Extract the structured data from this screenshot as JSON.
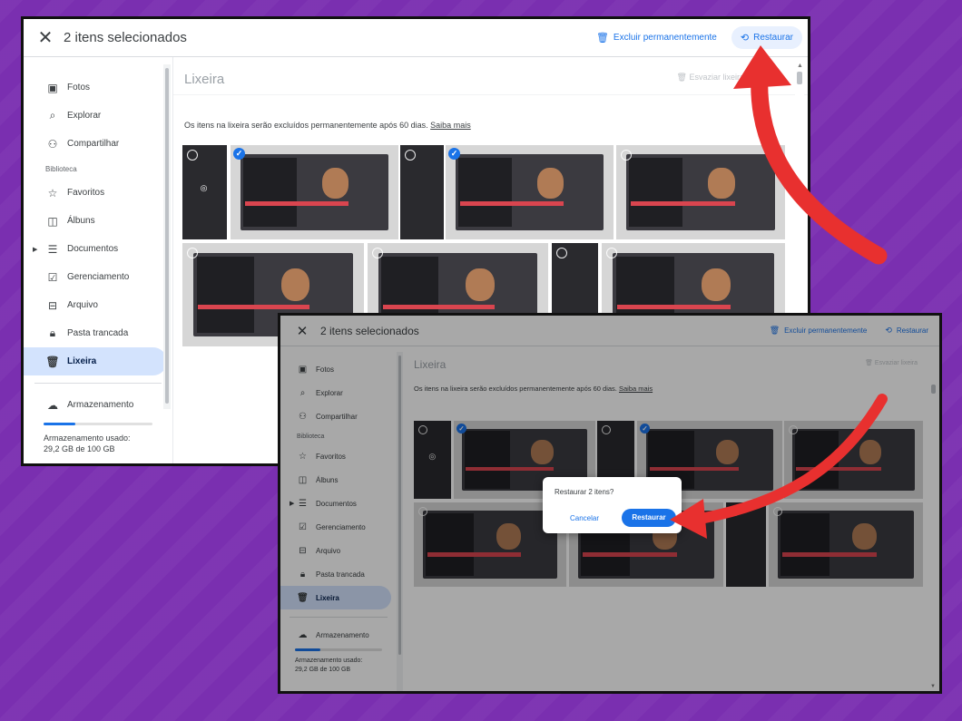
{
  "colors": {
    "background": "#7a2fb0",
    "accent": "#1a73e8",
    "arrow": "#e8302f",
    "active_nav": "#d3e3fd"
  },
  "topbar": {
    "close_icon": "close-icon",
    "title": "2 itens selecionados",
    "delete_label": "Excluir permanentemente",
    "restore_label": "Restaurar"
  },
  "sidebar": {
    "items": [
      {
        "label": "Fotos",
        "icon": "photo-icon"
      },
      {
        "label": "Explorar",
        "icon": "search-icon"
      },
      {
        "label": "Compartilhar",
        "icon": "people-icon"
      }
    ],
    "library_label": "Biblioteca",
    "library_items": [
      {
        "label": "Favoritos",
        "icon": "star-icon"
      },
      {
        "label": "Álbuns",
        "icon": "album-icon"
      },
      {
        "label": "Documentos",
        "icon": "document-icon"
      },
      {
        "label": "Gerenciamento",
        "icon": "checklist-icon"
      },
      {
        "label": "Arquivo",
        "icon": "archive-icon"
      },
      {
        "label": "Pasta trancada",
        "icon": "lock-icon"
      },
      {
        "label": "Lixeira",
        "icon": "trash-icon",
        "active": true
      }
    ],
    "storage_label": "Armazenamento",
    "storage_used_label": "Armazenamento usado:",
    "storage_value": "29,2 GB de 100 GB",
    "storage_fraction": 0.292
  },
  "main": {
    "title": "Lixeira",
    "empty_action": "Esvaziar lixeira",
    "note": "Os itens na lixeira serão excluídos permanentemente após 60 dias.",
    "learn_more": "Saiba mais"
  },
  "dialog": {
    "title": "Restaurar 2 itens?",
    "cancel_label": "Cancelar",
    "confirm_label": "Restaurar"
  }
}
